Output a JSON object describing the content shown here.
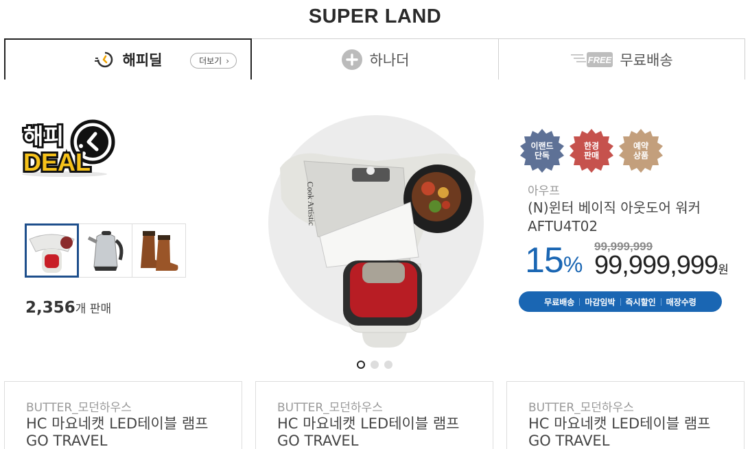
{
  "site_title": "SUPER LAND",
  "tabs": [
    {
      "label": "해피딜",
      "icon": "clock-arrow-icon",
      "more": "더보기"
    },
    {
      "label": "하나더",
      "icon": "plus-circle-icon"
    },
    {
      "label": "무료배송",
      "icon": "free-shipping-icon",
      "icon_text": "FREE"
    }
  ],
  "deal_logo": {
    "line1": "해피",
    "line2": "DEAL"
  },
  "thumbnails": [
    "kitchen-gadget-thumbnail",
    "electric-kettle-thumbnail",
    "brown-boots-thumbnail"
  ],
  "sold": {
    "count": "2,356",
    "suffix": "개 판매"
  },
  "product": {
    "badges": [
      {
        "text": "이랜드\n단독",
        "color": "#5e7196"
      },
      {
        "text": "한경\n판매",
        "color": "#c6524d"
      },
      {
        "text": "예약\n상품",
        "color": "#c39f7c"
      }
    ],
    "brand": "아우프",
    "name": "(N)윈터 베이직 아웃도어 워커 AFTU4T02",
    "discount": "15",
    "discount_unit": "%",
    "original_price": "99,999,999",
    "price": "99,999,999",
    "currency": "원",
    "tags": [
      "무료배송",
      "마감임박",
      "즉시할인",
      "매장수령"
    ],
    "image_text": "Cook Artistic"
  },
  "carousel": {
    "count": 3,
    "active": 1
  },
  "cards": [
    {
      "brand": "BUTTER_모던하우스",
      "title": "HC 마요네캣 LED테이블 램프",
      "subtitle": "GO TRAVEL"
    },
    {
      "brand": "BUTTER_모던하우스",
      "title": "HC 마요네캣 LED테이블 램프",
      "subtitle": "GO TRAVEL"
    },
    {
      "brand": "BUTTER_모던하우스",
      "title": "HC 마요네캣 LED테이블 램프",
      "subtitle": "GO TRAVEL"
    }
  ],
  "colors": {
    "accent": "#1a66b3",
    "thumb_border": "#1e4f8c",
    "logo_yellow": "#f6c21a"
  }
}
